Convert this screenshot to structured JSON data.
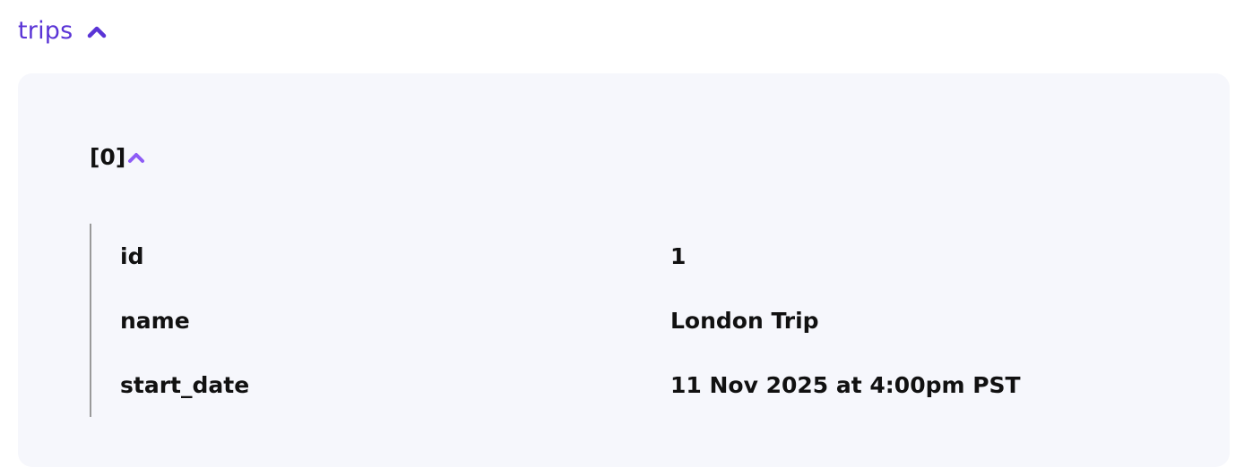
{
  "section": {
    "title": "trips",
    "toggle_icon": "chevron-up-icon",
    "accent_color": "#5a34d6"
  },
  "item": {
    "index_label": "[0]",
    "toggle_icon": "chevron-up-icon",
    "accent_color": "#8e5cf6"
  },
  "fields": [
    {
      "key": "id",
      "value": "1"
    },
    {
      "key": "name",
      "value": "London Trip"
    },
    {
      "key": "start_date",
      "value": "11 Nov 2025 at 4:00pm PST"
    }
  ]
}
